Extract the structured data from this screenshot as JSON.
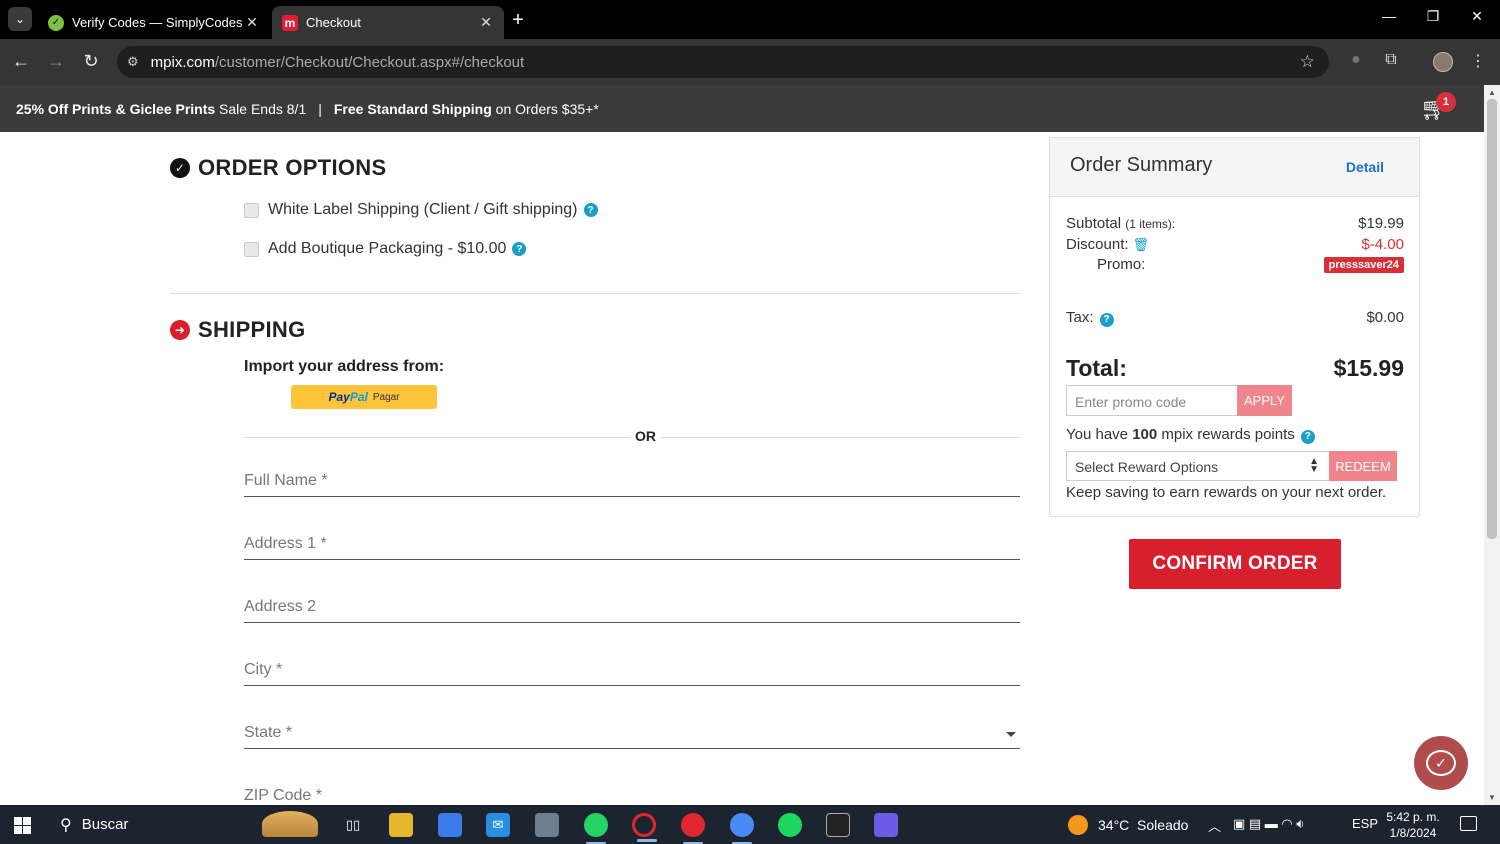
{
  "browser": {
    "tabs": [
      {
        "title": "Verify Codes — SimplyCodes"
      },
      {
        "title": "Checkout"
      }
    ],
    "url_host": "mpix.com",
    "url_path": "/customer/Checkout/Checkout.aspx#/checkout"
  },
  "banner": {
    "promo_bold": "25% Off Prints & Giclee Prints",
    "promo_rest": " Sale Ends 8/1",
    "separator": "|",
    "shipping_bold": "Free Standard Shipping",
    "shipping_rest": " on Orders $35+*",
    "cart_count": "1"
  },
  "order_options": {
    "title": "ORDER OPTIONS",
    "options": [
      {
        "label": "White Label Shipping (Client / Gift shipping)"
      },
      {
        "label": "Add Boutique Packaging - $10.00"
      }
    ]
  },
  "shipping": {
    "title": "SHIPPING",
    "import_label": "Import your address from:",
    "paypal": {
      "brand1": "Pay",
      "brand2": "Pal",
      "action": "Pagar"
    },
    "or_text": "OR",
    "fields": {
      "full_name": "Full Name *",
      "address1": "Address 1 *",
      "address2": "Address 2",
      "city": "City *",
      "state": "State *",
      "zip": "ZIP Code *"
    }
  },
  "summary": {
    "title": "Order Summary",
    "detail_link": "Detail",
    "subtotal_label": "Subtotal",
    "subtotal_items": "(1 items):",
    "subtotal_value": "$19.99",
    "discount_label": "Discount:",
    "discount_value": "$-4.00",
    "promo_label": "Promo:",
    "promo_code": "presssaver24",
    "tax_label": "Tax:",
    "tax_value": "$0.00",
    "total_label": "Total:",
    "total_value": "$15.99",
    "promo_placeholder": "Enter promo code",
    "apply_label": "APPLY",
    "rewards_prefix": "You have ",
    "rewards_points": "100",
    "rewards_suffix": " mpix rewards points",
    "reward_select": "Select Reward Options",
    "redeem_label": "REDEEM",
    "keep_saving": "Keep saving to earn rewards on your next order."
  },
  "confirm_label": "CONFIRM ORDER",
  "taskbar": {
    "search_label": "Buscar",
    "weather": "34°C  Soleado",
    "language": "ESP",
    "time": "5:42 p. m.",
    "date": "1/8/2024"
  },
  "colors": {
    "brand_red": "#d81f2e",
    "help_blue": "#1a9fc9",
    "link_blue": "#1a73c9"
  }
}
